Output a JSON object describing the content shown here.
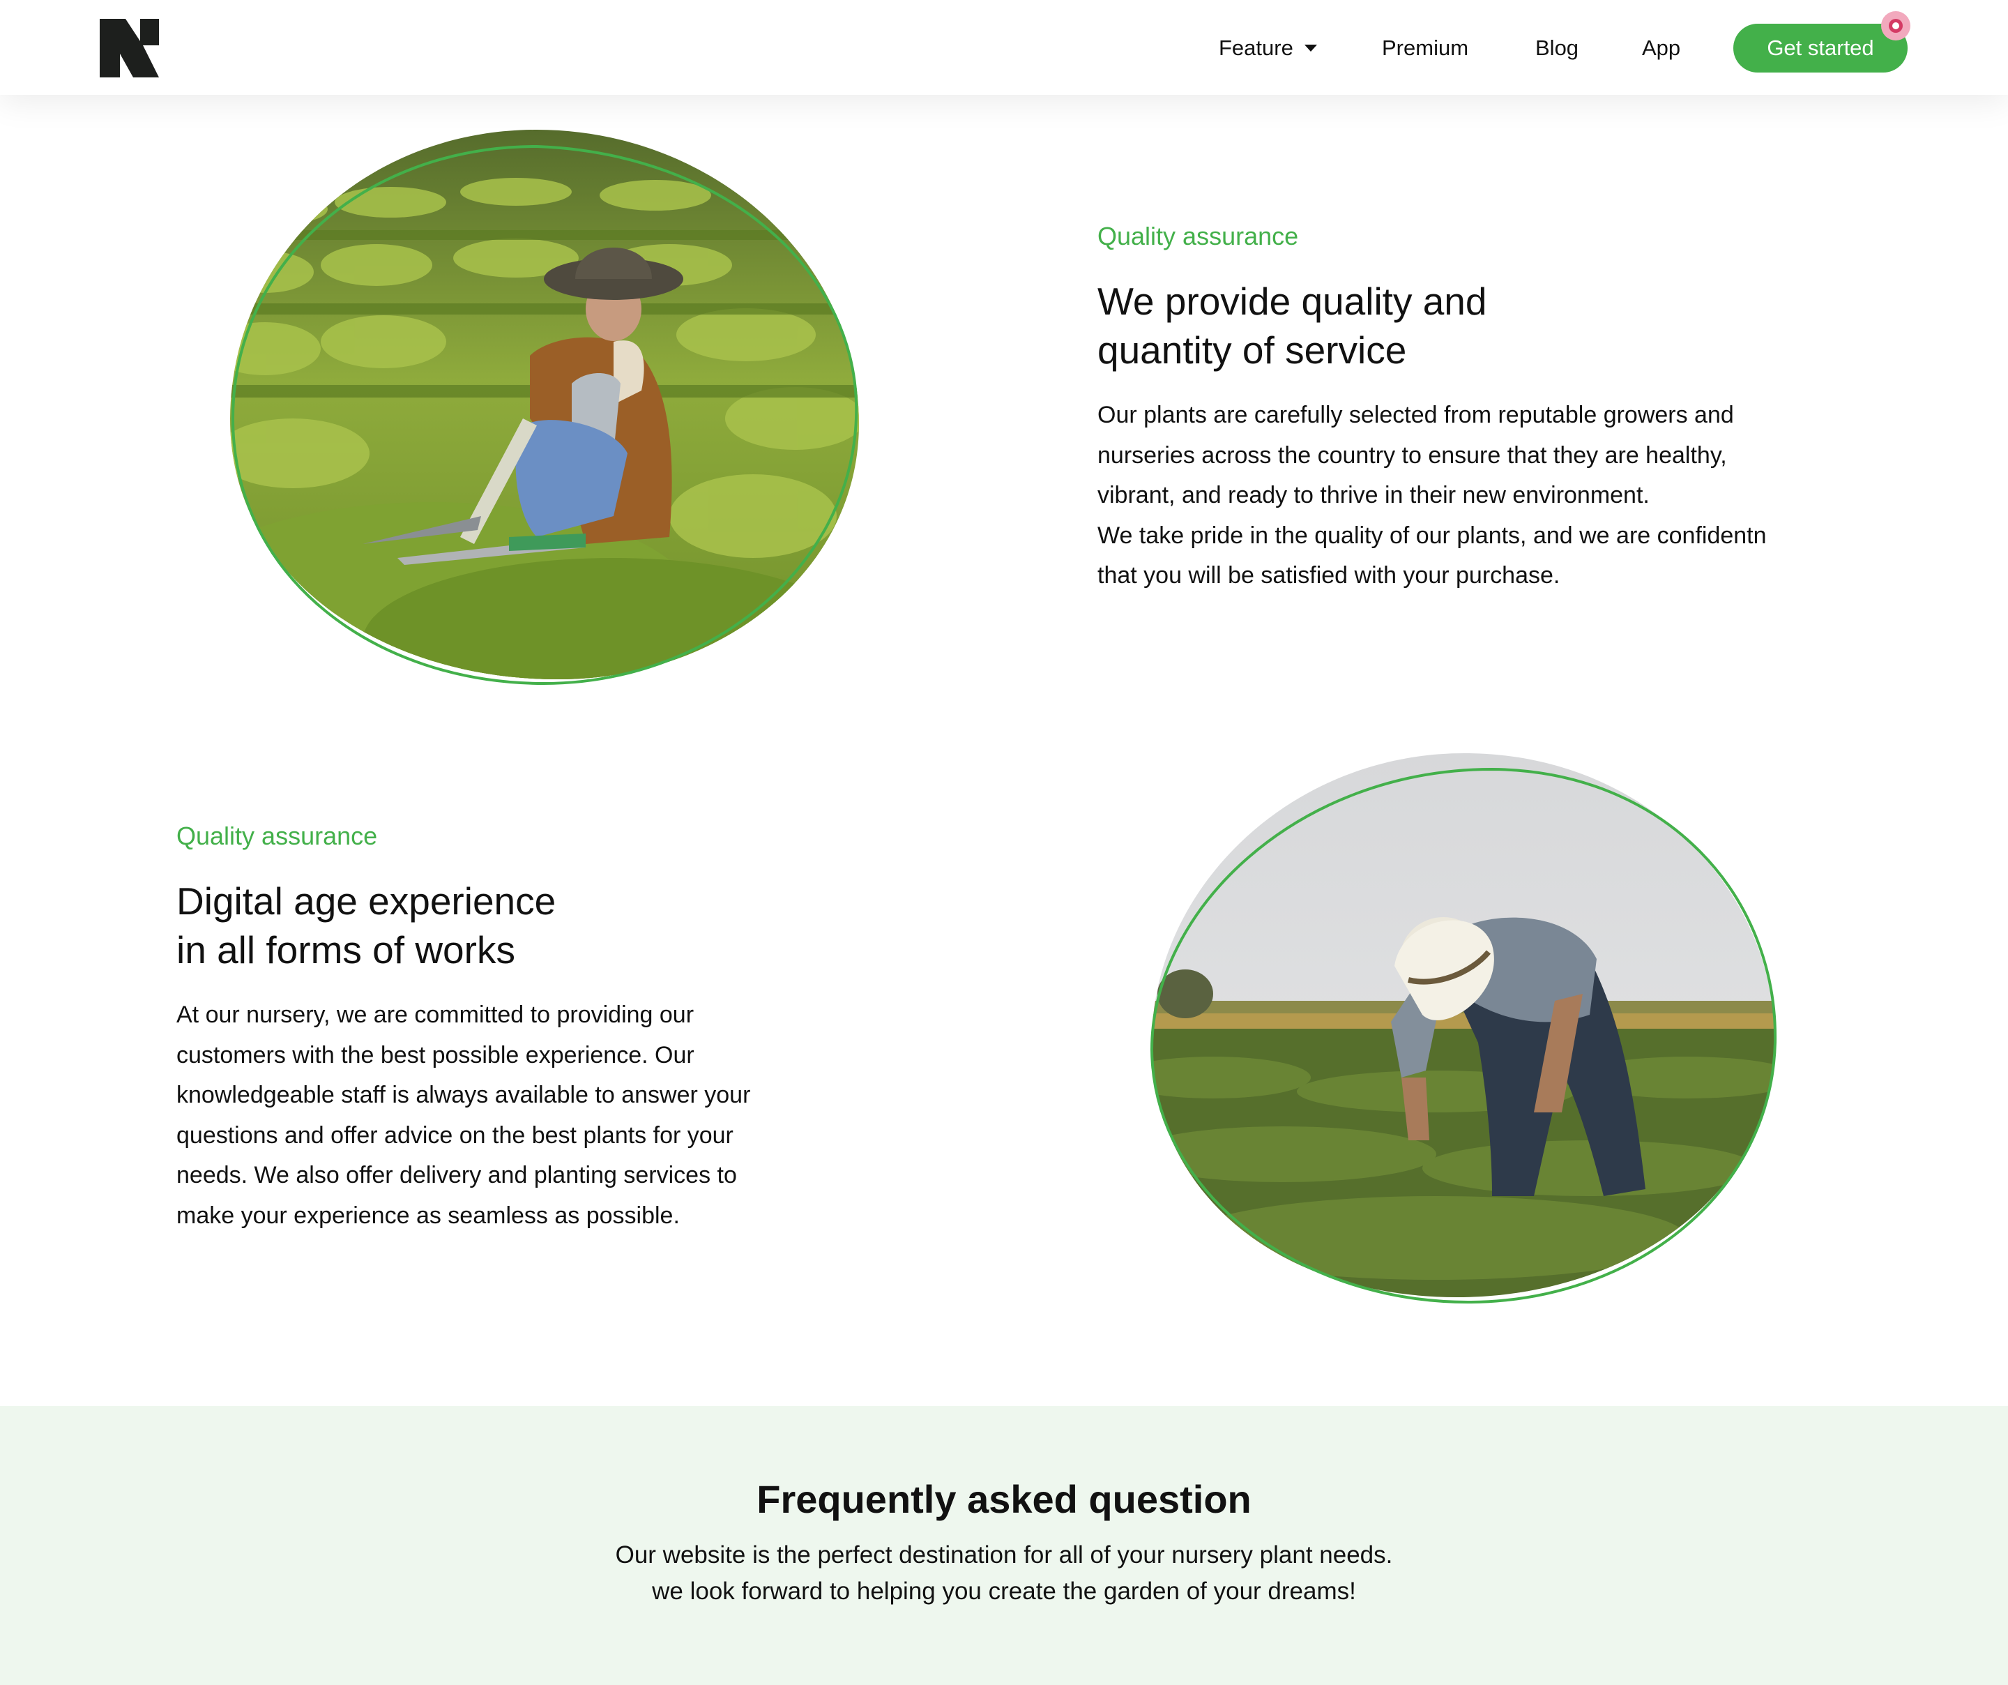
{
  "header": {
    "logo_icon": "n-logo-icon",
    "nav": [
      {
        "label": "Feature",
        "has_dropdown": true
      },
      {
        "label": "Premium"
      },
      {
        "label": "Blog"
      },
      {
        "label": "App"
      }
    ],
    "cta_label": "Get started"
  },
  "features": [
    {
      "eyebrow": "Quality assurance",
      "heading_lines": [
        "We provide quality and",
        "quantity of service"
      ],
      "body_lines": [
        "Our plants are carefully selected from reputable growers and",
        "nurseries across the country to ensure that they are healthy,",
        "vibrant, and ready to thrive in their new environment.",
        "We take pride in the quality of our plants, and we are confidentn",
        "that you will be satisfied with your purchase."
      ],
      "image_icon": "gardener-pruning-photo"
    },
    {
      "eyebrow": "Quality assurance",
      "heading_lines": [
        "Digital age experience",
        "in all forms of works"
      ],
      "body_lines": [
        "At our nursery, we are committed to providing our",
        "customers with the best possible experience. Our",
        "knowledgeable staff is always available to answer your",
        "questions and offer advice on the best plants for your",
        "needs. We also offer delivery and planting services to",
        "make your experience as seamless as possible."
      ],
      "image_icon": "farmer-field-photo"
    }
  ],
  "faq": {
    "title": "Frequently asked question",
    "subtitle_lines": [
      "Our website is the perfect destination for all of your nursery plant needs.",
      "we look forward to helping you create the garden of your dreams!"
    ]
  },
  "colors": {
    "accent": "#43b04a",
    "faq_background": "#eef7ee",
    "text": "#111111"
  }
}
